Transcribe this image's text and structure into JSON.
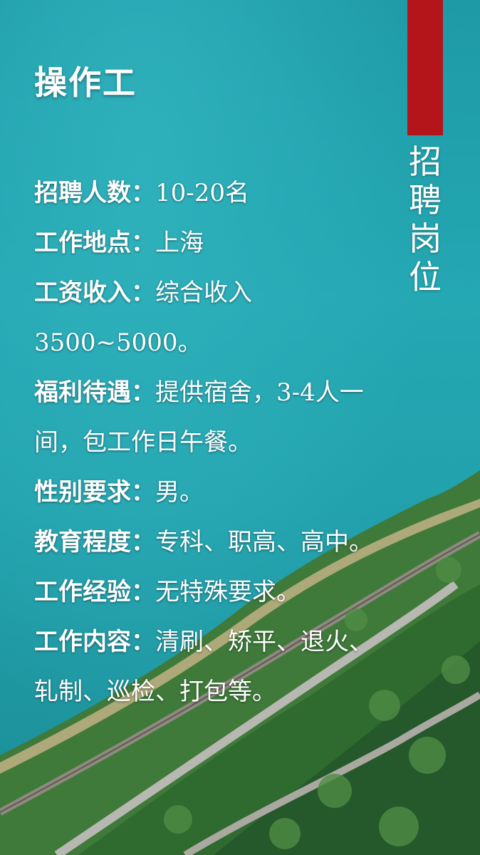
{
  "title": "操作工",
  "section_label": "招聘岗位",
  "colors": {
    "accent": "#b3151a",
    "water": "#22a1ac",
    "text": "#ffffff"
  },
  "items": [
    {
      "label": "招聘人数：",
      "value": "10-20名"
    },
    {
      "label": "工作地点：",
      "value": "上海"
    },
    {
      "label": "工资收入：",
      "value": "综合收入3500~5000。"
    },
    {
      "label": "福利待遇：",
      "value": "提供宿舍，3-4人一间，包工作日午餐。"
    },
    {
      "label": "性别要求：",
      "value": "男。"
    },
    {
      "label": "教育程度：",
      "value": "专科、职高、高中。"
    },
    {
      "label": "工作经验：",
      "value": "无特殊要求。"
    },
    {
      "label": "工作内容：",
      "value": "清刷、矫平、退火、轧制、巡检、打包等。"
    }
  ]
}
